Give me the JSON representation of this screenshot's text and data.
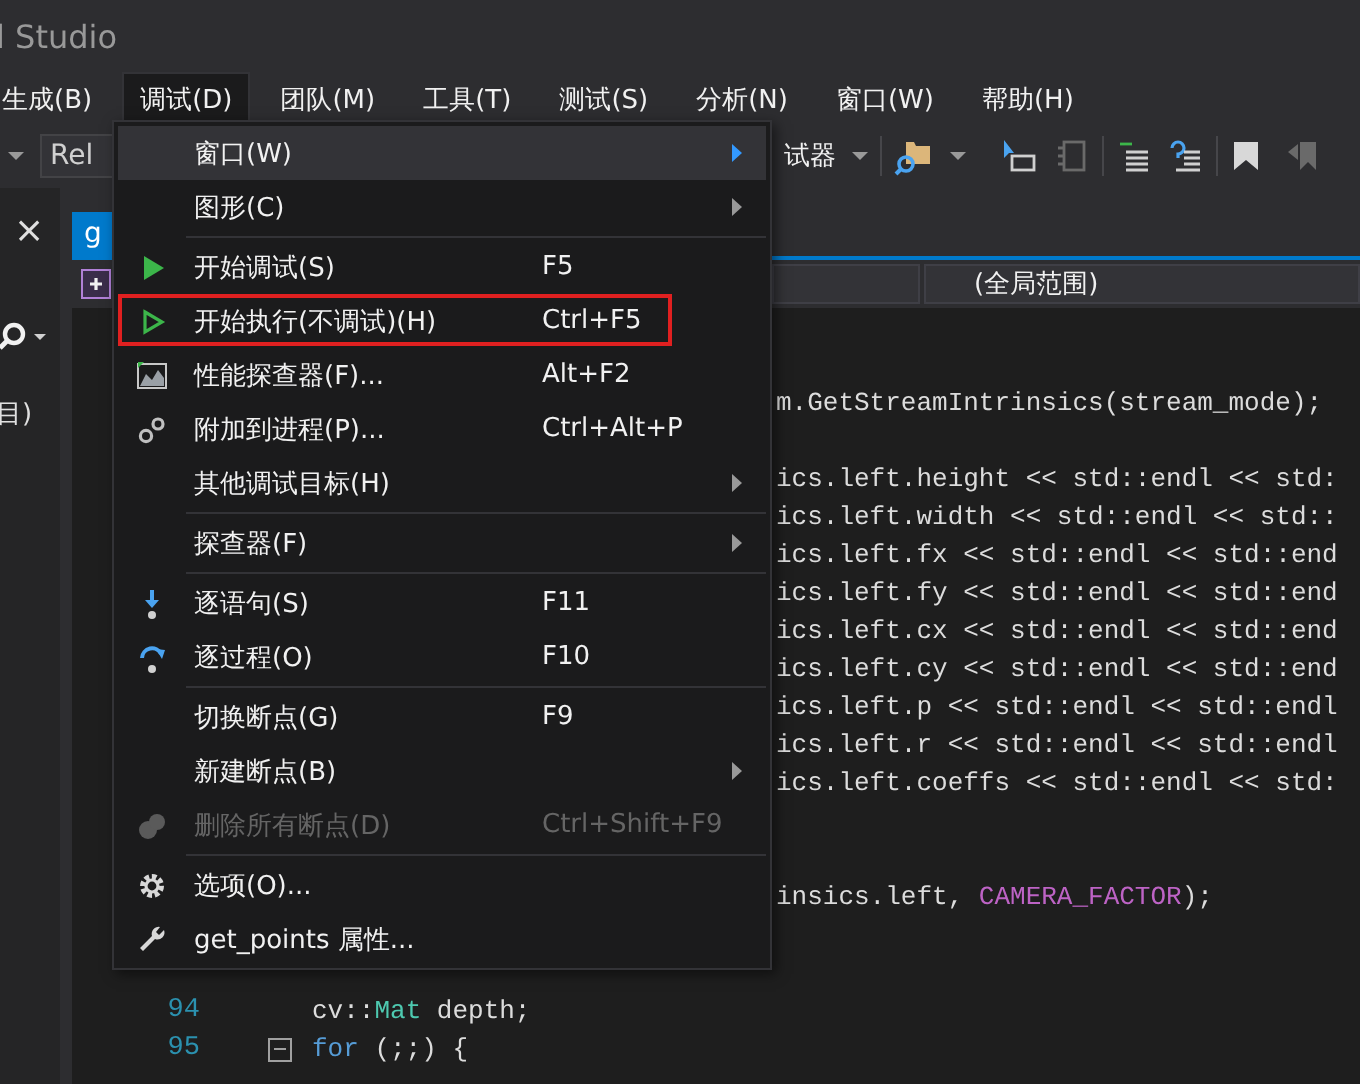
{
  "window": {
    "title": "l Studio"
  },
  "menu_bar": [
    {
      "label": "生成(B)",
      "selected": false
    },
    {
      "label": "调试(D)",
      "selected": true
    },
    {
      "label": "团队(M)",
      "selected": false
    },
    {
      "label": "工具(T)",
      "selected": false
    },
    {
      "label": "测试(S)",
      "selected": false
    },
    {
      "label": "分析(N)",
      "selected": false
    },
    {
      "label": "窗口(W)",
      "selected": false
    },
    {
      "label": "帮助(H)",
      "selected": false
    }
  ],
  "toolbar": {
    "configuration": "Rel",
    "debugger": "试器"
  },
  "side_panel": {
    "close": "×",
    "text": "目)"
  },
  "editor_tab": {
    "label": "g",
    "selected": true
  },
  "scope_bar": {
    "scope": "(全局范围)"
  },
  "code_beside_menu": [
    {
      "kind": "blank"
    },
    {
      "kind": "blank"
    },
    {
      "kind": "code",
      "segments": [
        {
          "kind": "plain",
          "text": "m.GetStreamIntrinsics(stream_mode);"
        }
      ]
    },
    {
      "kind": "blank"
    },
    {
      "kind": "code",
      "segments": [
        {
          "kind": "plain",
          "text": "ics.left.height << std::endl << std:"
        }
      ]
    },
    {
      "kind": "code",
      "segments": [
        {
          "kind": "plain",
          "text": "ics.left.width << std::endl << std::"
        }
      ]
    },
    {
      "kind": "code",
      "segments": [
        {
          "kind": "plain",
          "text": "ics.left.fx << std::endl << std::end"
        }
      ]
    },
    {
      "kind": "code",
      "segments": [
        {
          "kind": "plain",
          "text": "ics.left.fy << std::endl << std::end"
        }
      ]
    },
    {
      "kind": "code",
      "segments": [
        {
          "kind": "plain",
          "text": "ics.left.cx << std::endl << std::end"
        }
      ]
    },
    {
      "kind": "code",
      "segments": [
        {
          "kind": "plain",
          "text": "ics.left.cy << std::endl << std::end"
        }
      ]
    },
    {
      "kind": "code",
      "segments": [
        {
          "kind": "plain",
          "text": "ics.left.p << std::endl << std::endl"
        }
      ]
    },
    {
      "kind": "code",
      "segments": [
        {
          "kind": "plain",
          "text": "ics.left.r << std::endl << std::endl"
        }
      ]
    },
    {
      "kind": "code",
      "segments": [
        {
          "kind": "plain",
          "text": "ics.left.coeffs << std::endl << std:"
        }
      ]
    },
    {
      "kind": "blank"
    },
    {
      "kind": "blank"
    },
    {
      "kind": "code",
      "segments": [
        {
          "kind": "plain",
          "text": "insics.left, "
        },
        {
          "kind": "macro",
          "text": "CAMERA_FACTOR"
        },
        {
          "kind": "plain",
          "text": ");"
        }
      ]
    },
    {
      "kind": "blank"
    },
    {
      "kind": "blank"
    }
  ],
  "code_lines": [
    {
      "number": "94",
      "fold": false,
      "segments": [
        {
          "kind": "plain",
          "text": "cv::"
        },
        {
          "kind": "type",
          "text": "Mat"
        },
        {
          "kind": "plain",
          "text": " depth;"
        }
      ]
    },
    {
      "number": "95",
      "fold": true,
      "segments": [
        {
          "kind": "keyword",
          "text": "for"
        },
        {
          "kind": "plain",
          "text": " (;;) {"
        }
      ]
    }
  ],
  "debug_menu": [
    {
      "kind": "item",
      "label": "窗口(W)",
      "submenu": true,
      "disabled": false,
      "highlighted": true,
      "annotated": false
    },
    {
      "kind": "item",
      "label": "图形(C)",
      "submenu": true,
      "disabled": false,
      "highlighted": false,
      "annotated": false
    },
    {
      "kind": "separator"
    },
    {
      "kind": "item",
      "label": "开始调试(S)",
      "shortcut": "F5",
      "submenu": false,
      "disabled": false,
      "highlighted": false,
      "annotated": false
    },
    {
      "kind": "item",
      "label": "开始执行(不调试)(H)",
      "shortcut": "Ctrl+F5",
      "submenu": false,
      "disabled": false,
      "highlighted": false,
      "annotated": true
    },
    {
      "kind": "item",
      "label": "性能探查器(F)...",
      "shortcut": "Alt+F2",
      "submenu": false,
      "disabled": false,
      "highlighted": false,
      "annotated": false
    },
    {
      "kind": "item",
      "label": "附加到进程(P)...",
      "shortcut": "Ctrl+Alt+P",
      "submenu": false,
      "disabled": false,
      "highlighted": false,
      "annotated": false
    },
    {
      "kind": "item",
      "label": "其他调试目标(H)",
      "submenu": true,
      "disabled": false,
      "highlighted": false,
      "annotated": false
    },
    {
      "kind": "separator"
    },
    {
      "kind": "item",
      "label": "探查器(F)",
      "submenu": true,
      "disabled": false,
      "highlighted": false,
      "annotated": false
    },
    {
      "kind": "separator"
    },
    {
      "kind": "item",
      "label": "逐语句(S)",
      "shortcut": "F11",
      "submenu": false,
      "disabled": false,
      "highlighted": false,
      "annotated": false
    },
    {
      "kind": "item",
      "label": "逐过程(O)",
      "shortcut": "F10",
      "submenu": false,
      "disabled": false,
      "highlighted": false,
      "annotated": false
    },
    {
      "kind": "separator"
    },
    {
      "kind": "item",
      "label": "切换断点(G)",
      "shortcut": "F9",
      "submenu": false,
      "disabled": false,
      "highlighted": false,
      "annotated": false
    },
    {
      "kind": "item",
      "label": "新建断点(B)",
      "submenu": true,
      "disabled": false,
      "highlighted": false,
      "annotated": false
    },
    {
      "kind": "item",
      "label": "删除所有断点(D)",
      "shortcut": "Ctrl+Shift+F9",
      "submenu": false,
      "disabled": true,
      "highlighted": false,
      "annotated": false
    },
    {
      "kind": "separator"
    },
    {
      "kind": "item",
      "label": "选项(O)...",
      "submenu": false,
      "disabled": false,
      "highlighted": false,
      "annotated": false
    },
    {
      "kind": "item",
      "label": "get_points 属性...",
      "submenu": false,
      "disabled": false,
      "highlighted": false,
      "annotated": false
    }
  ]
}
